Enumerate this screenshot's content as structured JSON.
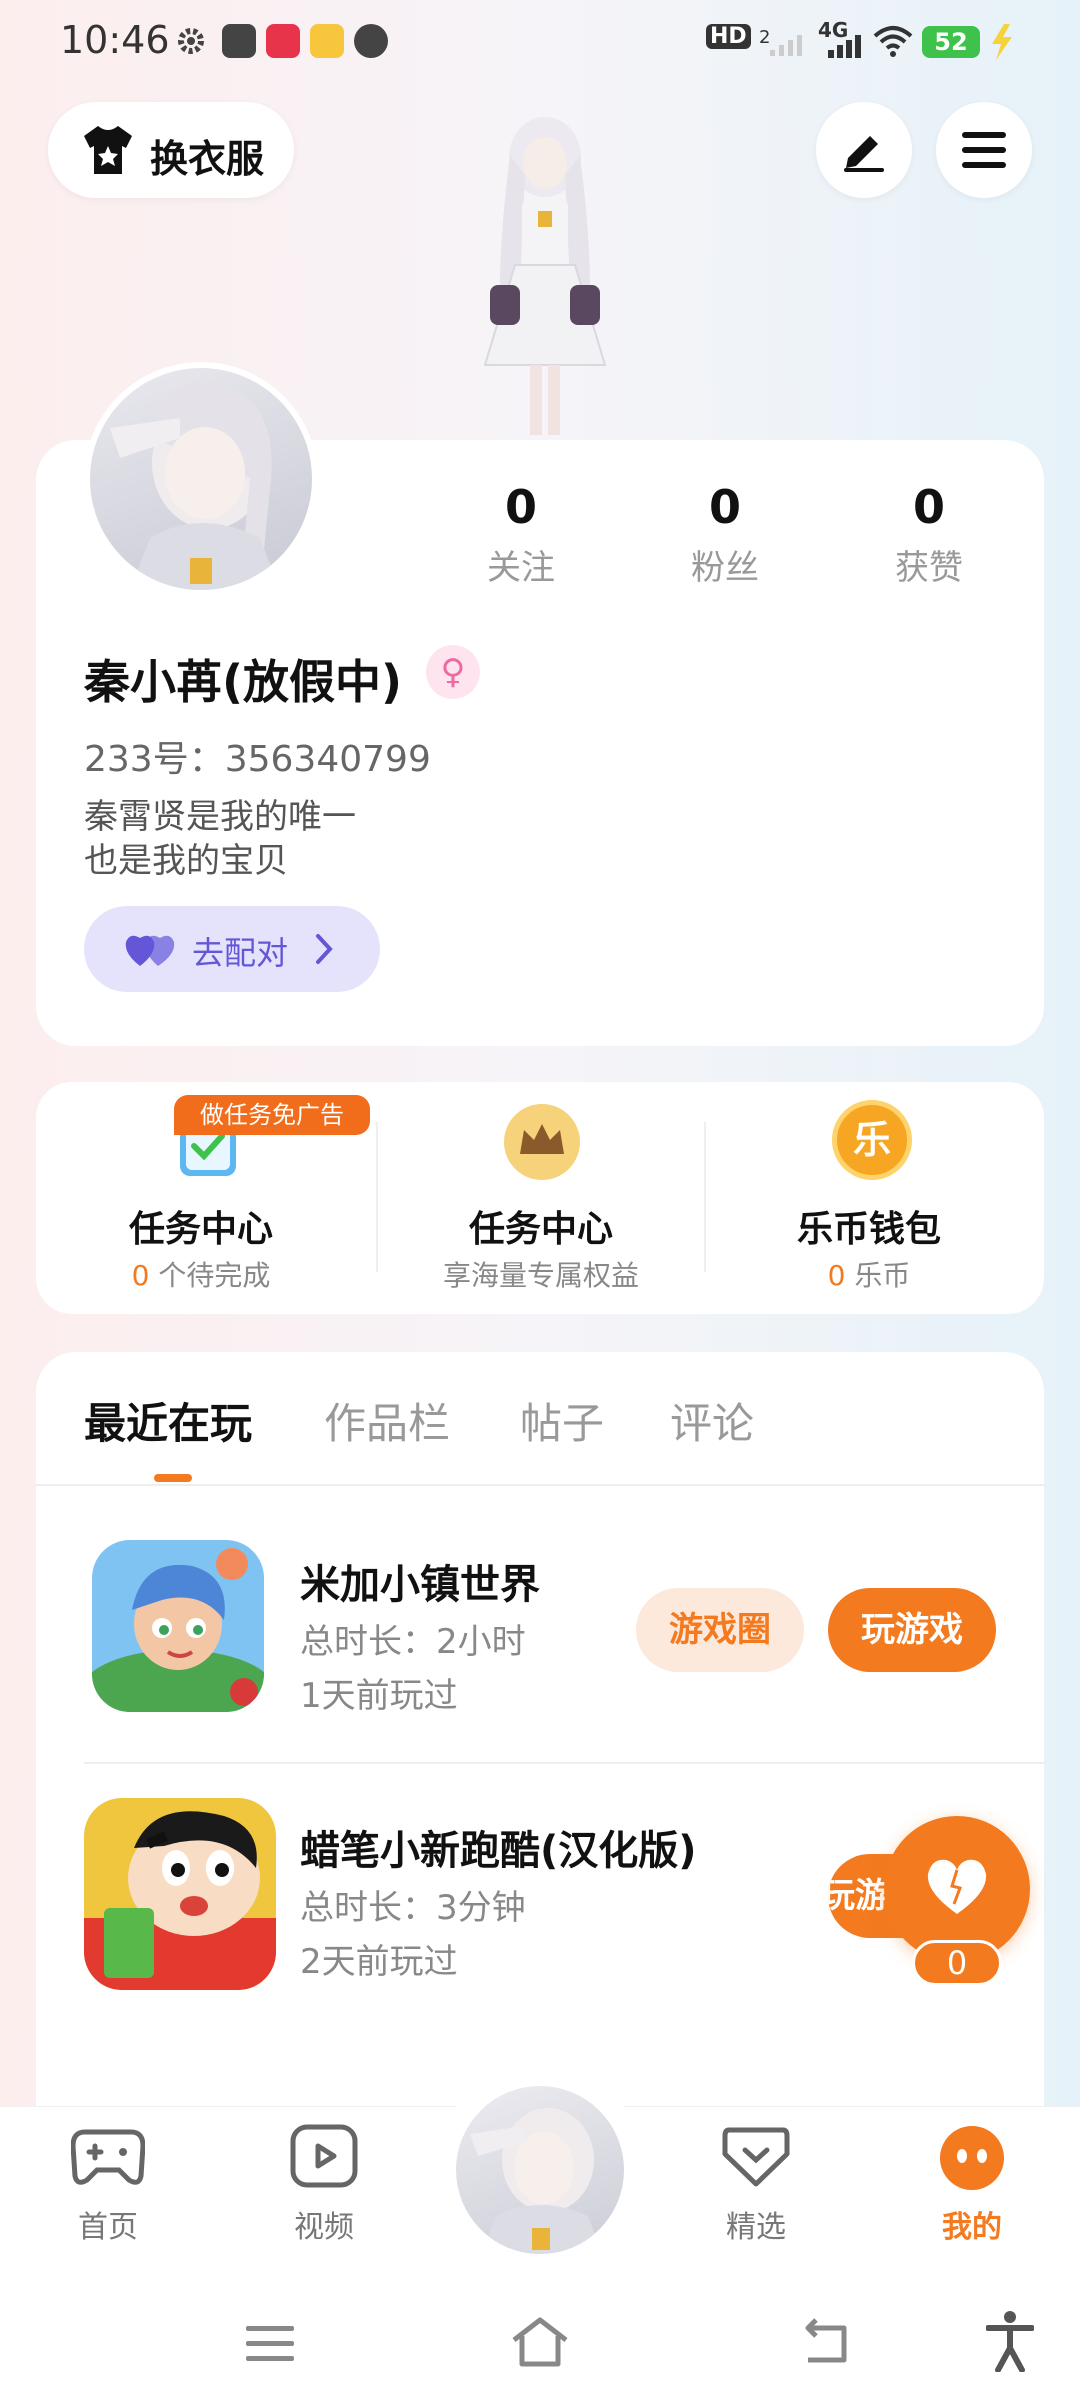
{
  "status_bar": {
    "time": "10:46",
    "network": "4G",
    "battery": "52",
    "hd_label": "HD",
    "sim": "2"
  },
  "header": {
    "outfit_label": "换衣服"
  },
  "profile": {
    "username": "秦小苒(放假中)",
    "uid": "233号：356340799",
    "bio_line1": "秦霄贤是我的唯一",
    "bio_line2": "也是我的宝贝",
    "match_label": "去配对",
    "gender_symbol": "♀",
    "stats": [
      {
        "value": "0",
        "label": "关注"
      },
      {
        "value": "0",
        "label": "粉丝"
      },
      {
        "value": "0",
        "label": "获赞"
      }
    ]
  },
  "tasks": {
    "promo_tag": "做任务免广告",
    "items": [
      {
        "title": "任务中心",
        "count": "0",
        "suffix": " 个待完成"
      },
      {
        "title": "任务中心",
        "sub": "享海量专属权益"
      },
      {
        "title": "乐币钱包",
        "count": "0",
        "suffix": " 乐币",
        "coin_char": "乐"
      }
    ]
  },
  "recent": {
    "tabs": [
      "最近在玩",
      "作品栏",
      "帖子",
      "评论"
    ],
    "games": [
      {
        "name": "米加小镇世界",
        "duration": "总时长：2小时",
        "last_played": "1天前玩过",
        "circle_label": "游戏圈",
        "play_label": "玩游戏"
      },
      {
        "name": "蜡笔小新跑酷(汉化版)",
        "duration": "总时长：3分钟",
        "last_played": "2天前玩过",
        "play_label": "玩游戏"
      }
    ]
  },
  "like_fab": {
    "count": "0"
  },
  "bottom_nav": [
    {
      "label": "首页",
      "icon": "gamepad-icon"
    },
    {
      "label": "视频",
      "icon": "video-icon"
    },
    {
      "label": "",
      "icon": "avatar"
    },
    {
      "label": "精选",
      "icon": "heart-box-icon"
    },
    {
      "label": "我的",
      "icon": "face-icon"
    }
  ],
  "colors": {
    "accent": "#f37a1f",
    "match_purple": "#6357d8",
    "battery_green": "#3ec24b"
  }
}
